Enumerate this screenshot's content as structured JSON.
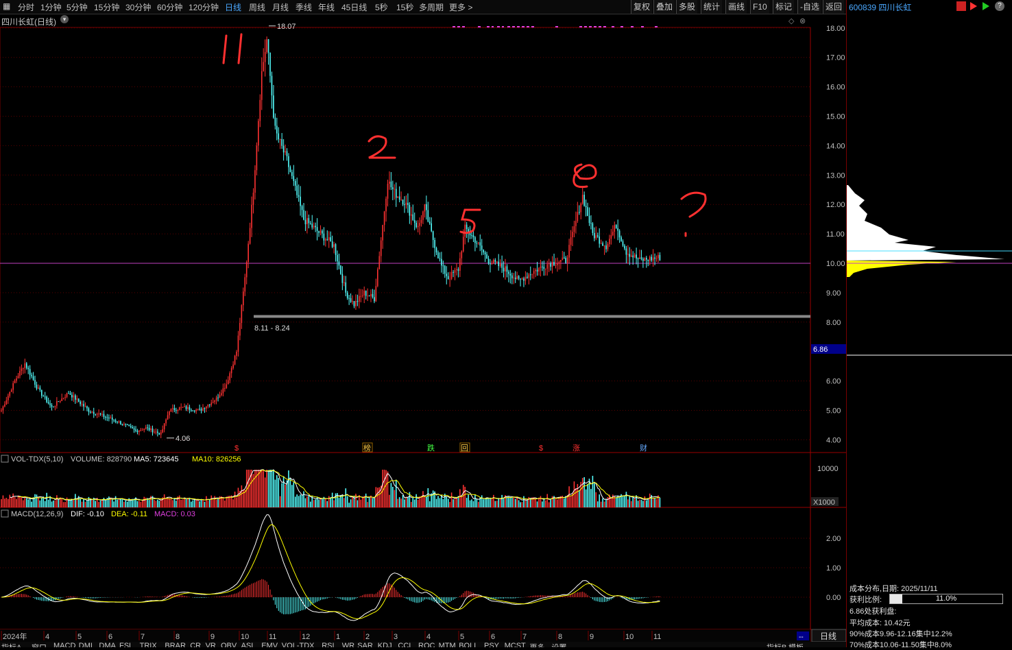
{
  "toolbar": {
    "periods": [
      "分时",
      "1分钟",
      "5分钟",
      "15分钟",
      "30分钟",
      "60分钟",
      "120分钟",
      "日线",
      "周线",
      "月线",
      "季线",
      "年线",
      "45日线",
      "5秒",
      "15秒",
      "多周期",
      "更多 >"
    ],
    "active_period": "日线",
    "right_buttons": [
      "复权",
      "叠加",
      "多股",
      "统计",
      "画线",
      "F10",
      "标记",
      "-自选",
      "返回"
    ]
  },
  "stock": {
    "code_name": "600839 四川长虹",
    "chart_title": "四川长虹(日线)"
  },
  "price_axis": {
    "labels": [
      "18.00",
      "17.00",
      "16.00",
      "15.00",
      "14.00",
      "13.00",
      "12.00",
      "11.00",
      "10.00",
      "9.00",
      "8.00",
      "6.00",
      "5.00",
      "4.00"
    ],
    "current_price_tag": "6.86"
  },
  "annotations": {
    "high": "18.07",
    "low": "4.06",
    "gap": "8.11 - 8.24",
    "handwritten": [
      "11",
      "2",
      "5",
      "8",
      "?"
    ]
  },
  "event_markers": [
    {
      "text": "$",
      "color": "#ff3030"
    },
    {
      "text": "榜",
      "color": "#ffcc44"
    },
    {
      "text": "跌",
      "color": "#44ff44"
    },
    {
      "text": "回",
      "color": "#ffcc44"
    },
    {
      "text": "$",
      "color": "#ff3030"
    },
    {
      "text": "涨",
      "color": "#ff3030"
    },
    {
      "text": "财",
      "color": "#66aaff"
    }
  ],
  "volume_pane": {
    "label_prefix": "VOL-TDX(5,10)",
    "volume": "VOLUME: 828790",
    "ma5": "MA5: 723645",
    "ma10": "MA10: 826256",
    "axis_label": "10000",
    "unit": "X1000"
  },
  "macd_pane": {
    "label_prefix": "MACD(12,26,9)",
    "dif": "DIF: -0.10",
    "dea": "DEA: -0.11",
    "macd": "MACD: 0.03",
    "axis_labels": [
      "2.00",
      "1.00",
      "0.00"
    ]
  },
  "date_axis": {
    "labels": [
      "2024年",
      "4",
      "5",
      "6",
      "7",
      "8",
      "9",
      "10",
      "11",
      "12",
      "1",
      "2",
      "3",
      "4",
      "5",
      "6",
      "7",
      "8",
      "9",
      "10",
      "11"
    ]
  },
  "bottom_tabs": [
    "指标A",
    "窗口",
    "MACD",
    "DMI",
    "DMA",
    "FSL",
    "TRIX",
    "BRAR",
    "CR",
    "VR",
    "OBV",
    "ASI",
    "EMV",
    "VOL-TDX",
    "RSI",
    "WR",
    "SAR",
    "KDJ",
    "CCI",
    "ROC",
    "MTM",
    "BOLL",
    "PSY",
    "MCST",
    "更多",
    "设置"
  ],
  "bottom_right": {
    "tab1": "指标B",
    "tab2": "模板",
    "period": "日线"
  },
  "cost_distribution": {
    "title": "成本分布,日期:  2025/11/11",
    "profit_label": "获利比例:",
    "profit_value": "11.0%",
    "profit_ratio": 0.11,
    "line3": "6.86处获利盘:",
    "avg_cost": "平均成本:  10.42元",
    "cost90": "90%成本9.96-12.16集中12.2%",
    "cost70": "70%成本10.06-11.50集中8.0%"
  },
  "colors": {
    "up": "#ff3232",
    "down": "#54ffff",
    "ma5": "#ffffff",
    "ma10": "#ffff00",
    "handwriting": "#ff3030",
    "hline": "#c040c0"
  }
}
